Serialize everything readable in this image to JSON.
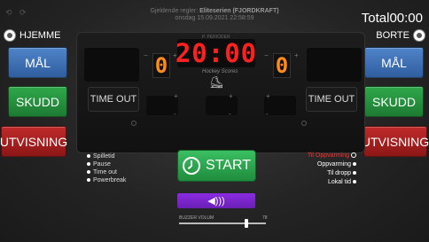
{
  "header": {
    "rules_label": "Gjeldende regler:",
    "rules_value": "Eliteserien (FJORDKRAFT)",
    "datetime": "onsdag 15.09.2021 22:58:59",
    "total_label": "Total",
    "total_time": "00:00"
  },
  "home": {
    "name": "HJEMME",
    "buttons": {
      "goal": "MÅL",
      "shots": "SKUDD",
      "penalty": "UTVISNING"
    },
    "score": "0",
    "timeout": "TIME OUT"
  },
  "away": {
    "name": "BORTE",
    "buttons": {
      "goal": "MÅL",
      "shots": "SKUDD",
      "penalty": "UTVISNING"
    },
    "score": "0",
    "timeout": "TIME OUT"
  },
  "scoreboard": {
    "clock": "20:00",
    "top_caption": "P. PERIODER",
    "brand": "Hockey Scores"
  },
  "left_options": [
    "Spilletid",
    "Pause",
    "Time out",
    "Powerbreak"
  ],
  "right_options": [
    {
      "label": "Til Oppvarming",
      "active": true
    },
    {
      "label": "Oppvarming",
      "active": false
    },
    {
      "label": "Til dropp",
      "active": false
    },
    {
      "label": "Lokal tid",
      "active": false
    }
  ],
  "controls": {
    "start_label": "START",
    "volume_label": "BUZZER VOLUM",
    "volume_value": "78"
  },
  "colors": {
    "clock": "#ff2020",
    "score": "#ff8c1a",
    "goal_button": "#3f74b8",
    "shots_button": "#27943f",
    "penalty_button": "#a82020",
    "start_button": "#2faa50",
    "sound_button": "#7b25cc",
    "active_option": "#ff3030"
  },
  "icons": {
    "team_logo": "team-logo-icon",
    "start": "clock-icon",
    "sound": "speaker-icon"
  }
}
